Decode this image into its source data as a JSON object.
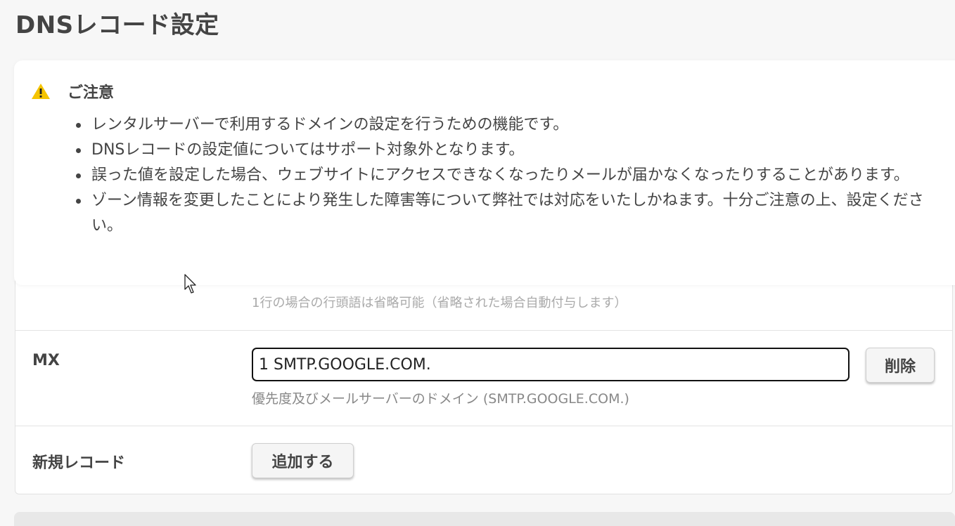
{
  "page": {
    "title": "DNSレコード設定"
  },
  "notice": {
    "title": "ご注意",
    "icon": "warning-icon",
    "icon_color": "#f5c400",
    "items": [
      "レンタルサーバーで利用するドメインの設定を行うための機能です。",
      "DNSレコードの設定値についてはサポート対象外となります。",
      "誤った値を設定した場合、ウェブサイトにアクセスできなくなったりメールが届かなくなったりすることがあります。",
      "ゾーン情報を変更したことにより発生した障害等について弊社では対応をいたしかねます。十分ご注意の上、設定ください。"
    ]
  },
  "form": {
    "partial_help": "1行の場合の行頭語は省略可能（省略された場合自動付与します）",
    "mx": {
      "label": "MX",
      "value": "1 SMTP.GOOGLE.COM.",
      "help": "優先度及びメールサーバーのドメイン (SMTP.GOOGLE.COM.)",
      "delete_label": "削除"
    },
    "new_record": {
      "label": "新規レコード",
      "add_label": "追加する"
    }
  }
}
